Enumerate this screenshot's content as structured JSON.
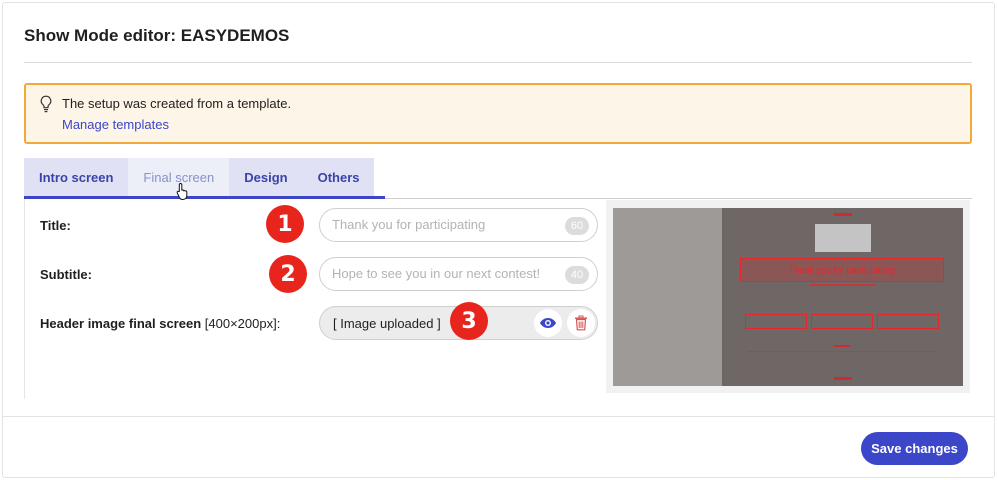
{
  "header": {
    "title": "Show Mode editor: EASYDEMOS"
  },
  "notice": {
    "message": "The setup was created from a template.",
    "link": "Manage templates",
    "icon": "lightbulb-icon",
    "border_color": "#f0a93a"
  },
  "tabs": [
    {
      "label": "Intro screen",
      "active": false
    },
    {
      "label": "Final screen",
      "active": true
    },
    {
      "label": "Design",
      "active": false
    },
    {
      "label": "Others",
      "active": false
    }
  ],
  "form": {
    "title": {
      "label": "Title:",
      "placeholder": "Thank you for participating",
      "value": "",
      "counter": "60",
      "marker": "1"
    },
    "subtitle": {
      "label": "Subtitle:",
      "placeholder": "Hope to see you in our next contest!",
      "value": "",
      "counter": "40",
      "marker": "2"
    },
    "header_image": {
      "label": "Header image final screen",
      "size_hint": "[400×200px]:",
      "status": "[ Image uploaded ]",
      "marker": "3",
      "view_icon": "eye-icon",
      "delete_icon": "trash-icon"
    }
  },
  "footer": {
    "save_label": "Save changes"
  },
  "colors": {
    "accent": "#3b46c8",
    "marker": "#e8251c",
    "danger": "#d9534f"
  }
}
